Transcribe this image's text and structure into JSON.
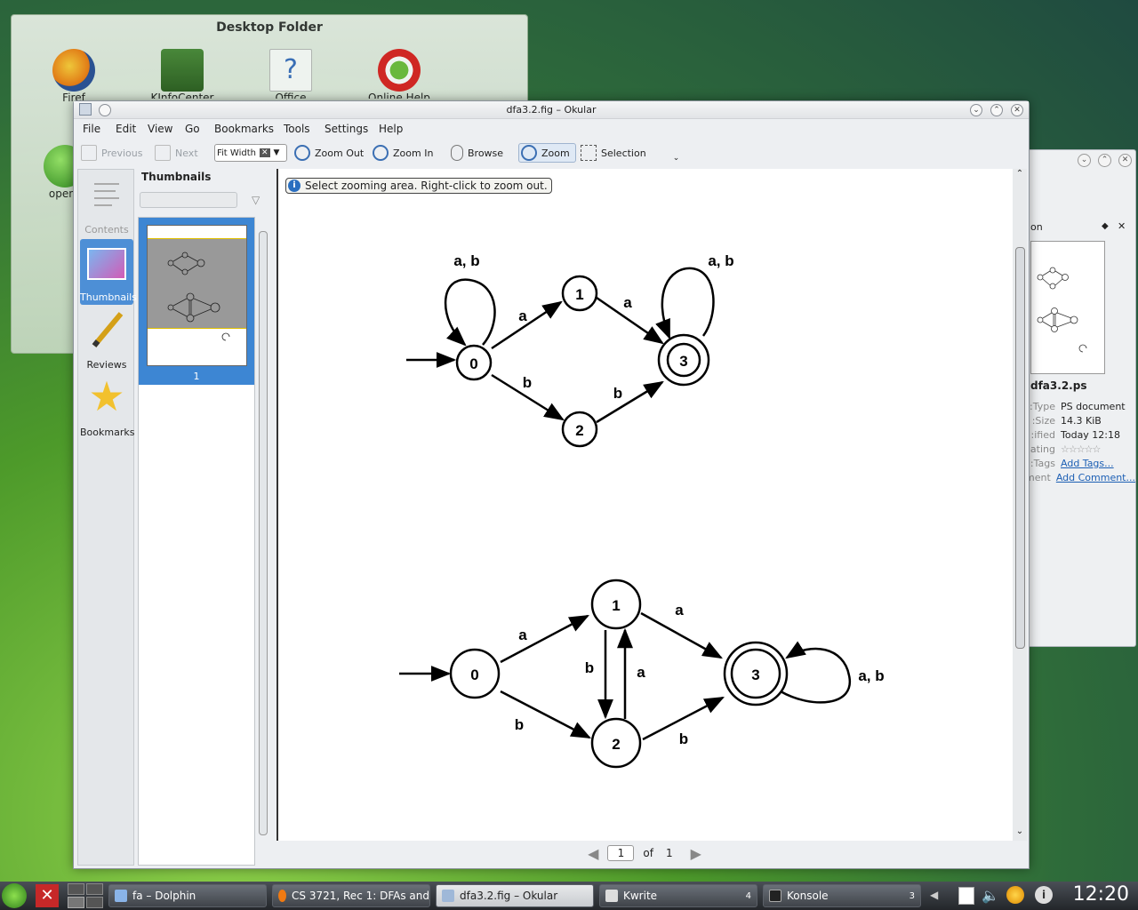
{
  "desktop_folder": {
    "title": "Desktop Folder",
    "icons": [
      {
        "label": "Firef",
        "icon": "firefox-icon"
      },
      {
        "label": "KInfoCenter",
        "icon": "kinfocenter-icon"
      },
      {
        "label": "Office",
        "icon": "help-icon"
      },
      {
        "label": "Online Help",
        "icon": "lifebuoy-icon"
      },
      {
        "label": "opens",
        "icon": "opensuse-icon"
      }
    ]
  },
  "bg_window": {
    "panel_title": "on",
    "file_name": "dfa3.2.ps",
    "info": [
      {
        "key": "Type:",
        "value": "PS document"
      },
      {
        "key": "Size:",
        "value": "14.3 KiB"
      },
      {
        "key": "ified:",
        "value": "Today 12:18"
      },
      {
        "key": "ating:",
        "value": "☆☆☆☆☆"
      },
      {
        "key": "Tags:",
        "value": "Add Tags..."
      },
      {
        "key": "ment:",
        "value": "Add Comment..."
      }
    ]
  },
  "window": {
    "title": "dfa3.2.fig – Okular"
  },
  "menu": [
    "File",
    "Edit",
    "View",
    "Go",
    "Bookmarks",
    "Tools",
    "Settings",
    "Help"
  ],
  "toolbar": {
    "previous": "Previous",
    "next": "Next",
    "zoom_mode": "Fit Width",
    "zoom_out": "Zoom Out",
    "zoom_in": "Zoom In",
    "browse": "Browse",
    "zoom": "Zoom",
    "selection": "Selection"
  },
  "sidebar": [
    {
      "label": "Contents",
      "icon": "contents-icon",
      "selected": false
    },
    {
      "label": "Thumbnails",
      "icon": "thumbnails-icon",
      "selected": true
    },
    {
      "label": "Reviews",
      "icon": "pencil-icon",
      "selected": false
    },
    {
      "label": "Bookmarks",
      "icon": "star-icon",
      "selected": false
    }
  ],
  "thumbnails": {
    "title": "Thumbnails",
    "page_label": "1"
  },
  "hint": "Select zooming area. Right-click to zoom out.",
  "diagram": {
    "dfa1": {
      "states": [
        "0",
        "1",
        "2",
        "3"
      ],
      "edge_labels": {
        "loop0": "a, b",
        "e01": "a",
        "e13": "a",
        "e02": "b",
        "e23": "b",
        "loop3": "a, b"
      }
    },
    "dfa2": {
      "states": [
        "0",
        "1",
        "2",
        "3"
      ],
      "edge_labels": {
        "e01": "a",
        "e13": "a",
        "e12": "b",
        "e21": "a",
        "e02": "b",
        "e23": "b",
        "loop3": "a, b"
      }
    }
  },
  "pagebar": {
    "current": "1",
    "of": "of",
    "total": "1"
  },
  "taskbar": {
    "tasks": [
      {
        "label": "fa – Dolphin",
        "active": false
      },
      {
        "label": "CS 3721, Rec 1: DFAs and",
        "active": false
      },
      {
        "label": "dfa3.2.fig – Okular",
        "active": true
      },
      {
        "label": "Kwrite",
        "active": false,
        "count": "4"
      },
      {
        "label": "Konsole",
        "active": false,
        "count": "3"
      }
    ],
    "clock": "12:20"
  }
}
